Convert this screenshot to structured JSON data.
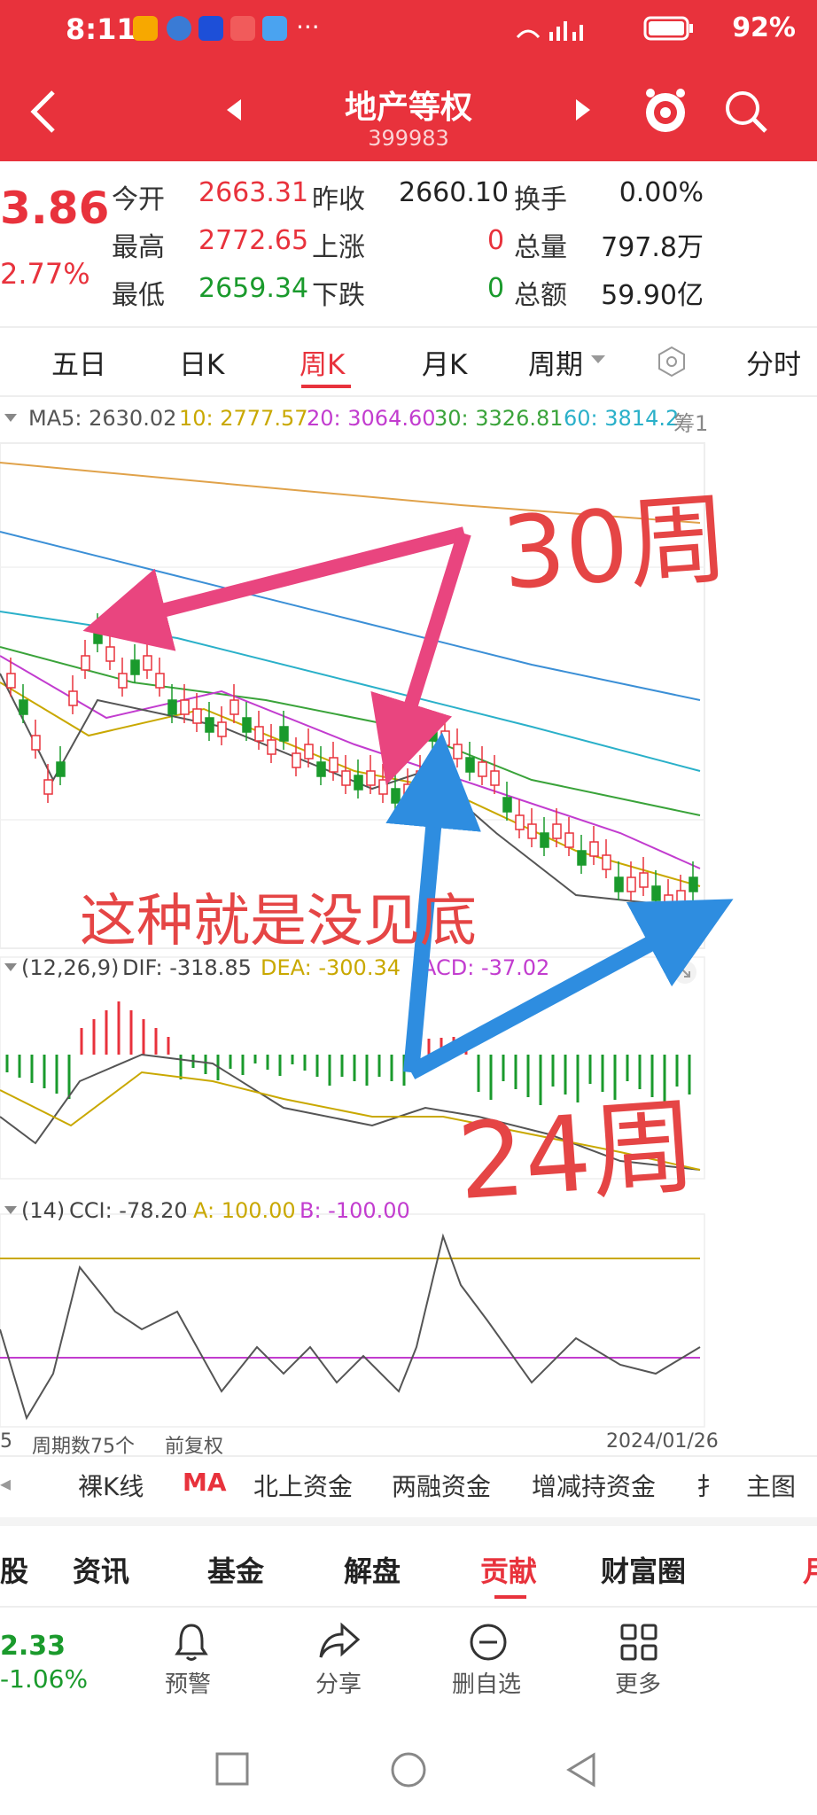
{
  "status_bar": {
    "time": "8:11",
    "battery": "92%"
  },
  "header": {
    "title": "地产等权",
    "code": "399983"
  },
  "quote": {
    "price": "3.86",
    "change_pct": "2.77%",
    "rows": [
      {
        "l1": "今开",
        "v1": "2663.31",
        "l2": "昨收",
        "v2": "2660.10",
        "l3": "换手",
        "v3": "0.00%"
      },
      {
        "l1": "最高",
        "v1": "2772.65",
        "l2": "上涨",
        "v2": "0",
        "l3": "总量",
        "v3": "797.8万"
      },
      {
        "l1": "最低",
        "v1": "2659.34",
        "l2": "下跌",
        "v2": "0",
        "l3": "总额",
        "v3": "59.90亿"
      }
    ]
  },
  "period_tabs": [
    "五日",
    "日K",
    "周K",
    "月K",
    "周期",
    "分时"
  ],
  "ma_legend": {
    "ma5": "MA5: 2630.02",
    "ma10": "10: 2777.57",
    "ma20": "20: 3064.60",
    "ma30": "30: 3326.81",
    "ma60": "60: 3814.2",
    "more": "筹1"
  },
  "macd_legend": {
    "params": "(12,26,9)",
    "dif": "DIF: -318.85",
    "dea": "DEA: -300.34",
    "macd": "ACD: -37.02"
  },
  "cci_legend": {
    "params": "(14)",
    "cci": "CCI: -78.20",
    "a": "A: 100.00",
    "b": "B: -100.00"
  },
  "chart_footer": {
    "left": "5",
    "count": "周期数75个",
    "adjust": "前复权",
    "date": "2024/01/26"
  },
  "annotations": {
    "top": "30周",
    "middle": "这种就是没见底",
    "bottom": "24周"
  },
  "indicator_tabs": [
    "裸K线",
    "MA",
    "北上资金",
    "两融资金",
    "增减持资金",
    "扌",
    "主图"
  ],
  "section_tabs": [
    "股",
    "资讯",
    "基金",
    "解盘",
    "贡献",
    "财富圈",
    "月"
  ],
  "bottom_bar": {
    "price": "2.33",
    "pct": "-1.06%",
    "items": [
      "预警",
      "分享",
      "删自选",
      "更多"
    ]
  },
  "colors": {
    "brand_red": "#e8323c",
    "down_green": "#1a9a2c",
    "arrow_pink": "#e9457f",
    "arrow_blue": "#2e8de0"
  }
}
